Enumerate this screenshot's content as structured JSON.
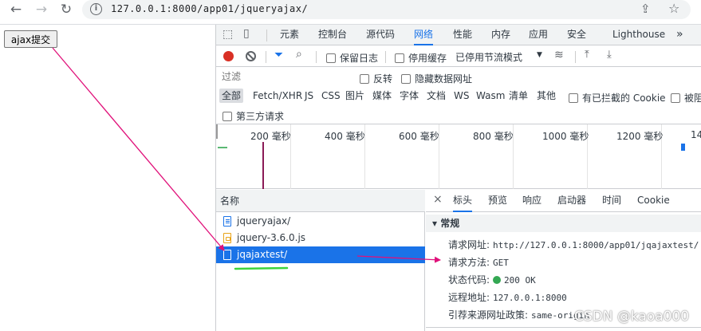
{
  "browser": {
    "url": "127.0.0.1:8000/app01/jqueryajax/"
  },
  "page": {
    "button_label": "ajax提交"
  },
  "devtools": {
    "tabs": [
      "元素",
      "控制台",
      "源代码",
      "网络",
      "性能",
      "内存",
      "应用",
      "安全",
      "Lighthouse"
    ],
    "more_tabs": "»",
    "toolbar": {
      "preserve_log": "保留日志",
      "disable_cache": "停用缓存",
      "throttling": "已停用节流模式"
    },
    "filter": {
      "placeholder": "过滤",
      "invert": "反转",
      "hide_data_urls": "隐藏数据网址"
    },
    "types": [
      "全部",
      "Fetch/XHR",
      "JS",
      "CSS",
      "图片",
      "媒体",
      "字体",
      "文档",
      "WS",
      "Wasm",
      "清单",
      "其他"
    ],
    "blocked_cookies": "有已拦截的 Cookie",
    "blocked_requests": "被阻",
    "third_party": "第三方请求",
    "timeline_ticks": [
      "200 毫秒",
      "400 毫秒",
      "600 毫秒",
      "800 毫秒",
      "1000 毫秒",
      "1200 毫秒",
      "14"
    ],
    "request_list": {
      "header": "名称",
      "items": [
        {
          "name": "jqueryajax/"
        },
        {
          "name": "jquery-3.6.0.js"
        },
        {
          "name": "jqajaxtest/"
        }
      ]
    },
    "details": {
      "close": "×",
      "tabs": [
        "标头",
        "预览",
        "响应",
        "启动器",
        "时间",
        "Cookie"
      ],
      "section": "▾ 常规",
      "general": {
        "url_label": "请求网址:",
        "url_value": "http://127.0.0.1:8000/app01/jqajaxtest/",
        "method_label": "请求方法:",
        "method_value": "GET",
        "status_label": "状态代码:",
        "status_value": "200 OK",
        "remote_label": "远程地址:",
        "remote_value": "127.0.0.1:8000",
        "referrer_label": "引荐来源网址政策:",
        "referrer_value": "same-origin"
      }
    }
  },
  "watermark": "CSDN @kaoa000",
  "colors": {
    "accent": "#1a73e8",
    "annotation_arrow": "#e0117a",
    "annotation_underline": "#3cd43c",
    "status_ok": "#34a853"
  }
}
